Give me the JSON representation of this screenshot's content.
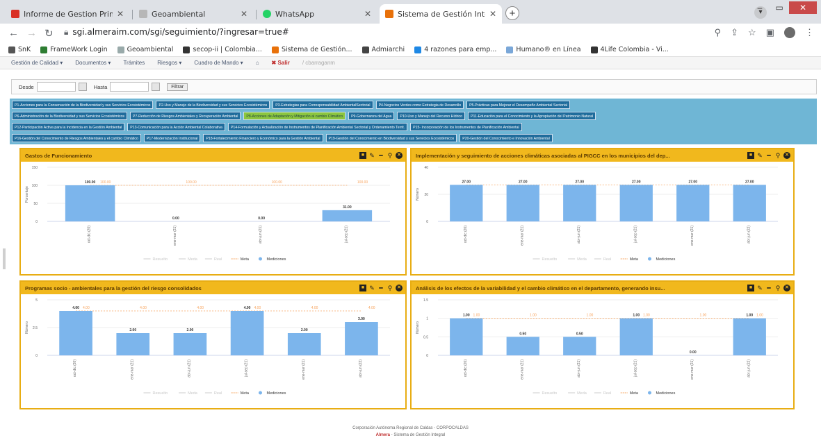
{
  "browser": {
    "tabs": [
      {
        "title": "Informe de Gestion Primer seme",
        "favicon_color": "#d93025"
      },
      {
        "title": "Geoambiental",
        "favicon_color": "#b7b7b7"
      },
      {
        "title": "WhatsApp",
        "favicon_color": "#25d366"
      },
      {
        "title": "Sistema de Gestión Integral - Al",
        "favicon_color": "#e8710a"
      }
    ],
    "url": "sgi.almeraim.com/sgi/seguimiento/?ingresar=true#",
    "bookmarks": [
      {
        "label": "SnK",
        "color": "#555"
      },
      {
        "label": "FrameWork Login",
        "color": "#2e7d32"
      },
      {
        "label": "Geoambiental",
        "color": "#9aa"
      },
      {
        "label": "secop-ii | Colombia...",
        "color": "#333"
      },
      {
        "label": "Sistema de Gestión...",
        "color": "#e8710a"
      },
      {
        "label": "Admiarchi",
        "color": "#444"
      },
      {
        "label": "4 razones para emp...",
        "color": "#1e88e5"
      },
      {
        "label": "Humano® en Línea",
        "color": "#7aa7d8"
      },
      {
        "label": "4Life Colombia - Vi...",
        "color": "#333"
      }
    ]
  },
  "app_menu": {
    "items": [
      "Gestión de Calidad ▾",
      "Documentos ▾",
      "Trámites",
      "Riesgos ▾",
      "Cuadro de Mando ▾"
    ],
    "exit": "Salir",
    "user": "cbarraganm"
  },
  "filter": {
    "from_label": "Desde",
    "to_label": "Hasta",
    "button": "Filtrar"
  },
  "programs": {
    "rows": [
      [
        {
          "label": "P1-Acciones para la Conservación de la Biodiversidad y sus Servicios Ecosistémicos",
          "active": false
        },
        {
          "label": "P2-Uso y Manejo de la Biodiversidad y sus Servicios Ecosistémicos",
          "active": false
        },
        {
          "label": "P3-Estrategias para Corresponsabilidad AmbientalSectorial",
          "active": false
        },
        {
          "label": "P4-Negocios Verdes como Estrategia de Desarrollo",
          "active": false
        },
        {
          "label": "P5-Prácticas para Mejorar el Desempeño Ambiental Sectorial",
          "active": false
        }
      ],
      [
        {
          "label": "P6-Administración de la Biodiversidad y sus Servicios Ecosistémicos",
          "active": false
        },
        {
          "label": "P7-Reducción de Riesgos Ambientales y Recuperación Ambiental",
          "active": false
        },
        {
          "label": "P8-Acciones de Adaptación y Mitigación al cambio Climático",
          "active": true
        },
        {
          "label": "P9-Gobernanza del Agua",
          "active": false
        },
        {
          "label": "P10-Uso y Manejo del Recurso Hídrico",
          "active": false
        },
        {
          "label": "P11-Educación para el Conocimiento y la Apropiación del Patrimonio Natural",
          "active": false
        }
      ],
      [
        {
          "label": "P12-Participación Activa para la Incidencia en la Gestión Ambiental",
          "active": false
        },
        {
          "label": "P13-Comunicación para la Acción Ambiental Colaborativa",
          "active": false
        },
        {
          "label": "P14-Formulación y Actualización de Instrumentos de Planificación Ambiental Sectorial y Ordenamiento Territ.",
          "active": false
        },
        {
          "label": "P15- Incorporación de los Instrumentos de Planificación Ambiental",
          "active": false
        }
      ],
      [
        {
          "label": "P16-Gestión del Conocimiento de Riesgos Ambientales y el cambio Climático",
          "active": false
        },
        {
          "label": "P17-Modernización Institucional",
          "active": false
        },
        {
          "label": "P18-Fortalecimiento Financiero y Económico para la Gestión Ambiental",
          "active": false
        },
        {
          "label": "P19-Gestión del Conocimiento en Biodiversidad y sus Servicios Ecosistémicos",
          "active": false
        },
        {
          "label": "P20-Gestión del Conocimiento e Innovación Ambiental",
          "active": false
        }
      ]
    ]
  },
  "legend": {
    "items": [
      "Resuelto",
      "Meda",
      "Real",
      "Meta",
      "Mediciones"
    ]
  },
  "chart_data": [
    {
      "type": "bar",
      "title": "Gastos de Funcionamiento",
      "ylabel": "Porcentaje",
      "ylim": [
        0,
        150
      ],
      "yticks": [
        "0",
        "50",
        "100",
        "150"
      ],
      "categories": [
        "oct-dic (20)",
        "ene-mar (21)",
        "abr-jun (21)",
        "jul-sep (21)"
      ],
      "series": [
        {
          "name": "Mediciones",
          "values": [
            100,
            0,
            0,
            31
          ],
          "labels": [
            "100.00",
            "0.00",
            "0.00",
            "31.00"
          ]
        },
        {
          "name": "Meta",
          "values": [
            100,
            100,
            100,
            100
          ],
          "labels": [
            "100.00",
            "100.00",
            "100.00",
            "100.00"
          ]
        }
      ]
    },
    {
      "type": "bar",
      "title": "Implementación y seguimiento de acciones climáticas asociadas al PIGCC en los municipios del dep...",
      "ylabel": "Número",
      "ylim": [
        0,
        40
      ],
      "yticks": [
        "0",
        "20",
        "40"
      ],
      "categories": [
        "oct-dic (20)",
        "ene-mar (21)",
        "abr-jun (21)",
        "jul-sep (21)",
        "ene-mar (21)",
        "abr-jun (22)"
      ],
      "series": [
        {
          "name": "Mediciones",
          "values": [
            27,
            27,
            27,
            27,
            27,
            27
          ],
          "labels": [
            "27.00",
            "27.00",
            "27.00",
            "27.00",
            "27.00",
            "27.00"
          ]
        },
        {
          "name": "Meta",
          "values": [
            27,
            27,
            27,
            27,
            27,
            27
          ],
          "labels": []
        }
      ]
    },
    {
      "type": "bar",
      "title": "Programas socio - ambientales para la gestión del riesgo consolidados",
      "ylabel": "Número",
      "ylim": [
        0,
        5
      ],
      "yticks": [
        "0",
        "2.5",
        "5"
      ],
      "categories": [
        "oct-dic (20)",
        "ene-mar (21)",
        "abr-jun (21)",
        "jul-sep (21)",
        "ene-mar (21)",
        "abr-jun (22)"
      ],
      "series": [
        {
          "name": "Mediciones",
          "values": [
            4,
            2,
            2,
            4,
            2,
            3
          ],
          "labels": [
            "4.00",
            "2.00",
            "2.00",
            "4.00",
            "2.00",
            "3.00"
          ]
        },
        {
          "name": "Meta",
          "values": [
            4,
            4,
            4,
            4,
            4,
            4
          ],
          "labels": [
            "4.00",
            "4.00",
            "4.00",
            "4.00",
            "4.00",
            "4.00"
          ]
        }
      ]
    },
    {
      "type": "bar",
      "title": "Análisis de los efectos de la variabilidad y el cambio climático en el departamento, generando insu...",
      "ylabel": "Número",
      "ylim": [
        0,
        1.5
      ],
      "yticks": [
        "0",
        "0.5",
        "1",
        "1.5"
      ],
      "categories": [
        "oct-dic (20)",
        "ene-mar (21)",
        "abr-jun (21)",
        "jul-sep (21)",
        "ene-mar (21)",
        "abr-jun (22)"
      ],
      "series": [
        {
          "name": "Mediciones",
          "values": [
            1,
            0.5,
            0.5,
            1,
            0,
            1
          ],
          "labels": [
            "1.00",
            "0.50",
            "0.50",
            "1.00",
            "0.00",
            "1.00"
          ]
        },
        {
          "name": "Meta",
          "values": [
            1,
            1,
            1,
            1,
            1,
            1
          ],
          "labels": [
            "1.00",
            "1.00",
            "1.00",
            "1.00",
            "1.00",
            "1.00"
          ]
        }
      ]
    }
  ],
  "footer": {
    "org": "Corporación Autónoma Regional de Caldas - CORPOCALDAS",
    "brand": "Almera",
    "system": " - Sistema de Gestión Integral"
  },
  "colors": {
    "bar": "#7cb5ec",
    "meta": "#f7a35c",
    "panel_header": "#f1b81d",
    "program_bg": "#6fb6d5",
    "program_btn": "#1f6c9c",
    "program_active": "#8cc63f"
  }
}
